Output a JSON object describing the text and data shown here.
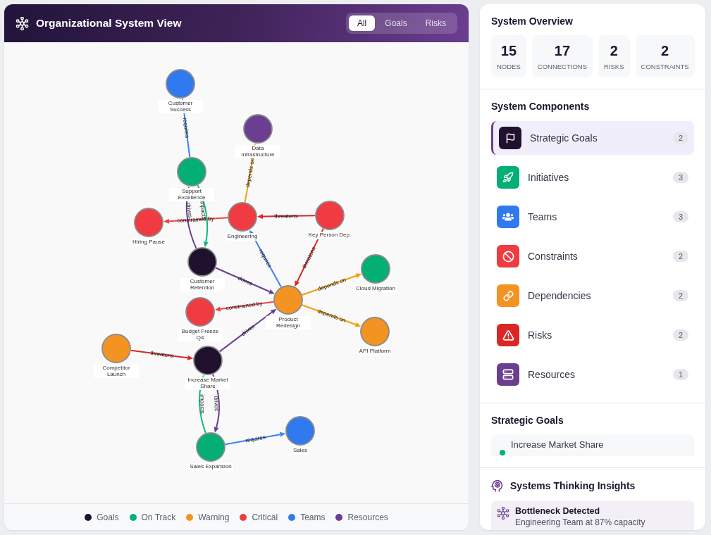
{
  "header": {
    "title": "Organizational System View",
    "tabs": [
      {
        "label": "All",
        "selected": true
      },
      {
        "label": "Goals",
        "selected": false
      },
      {
        "label": "Risks",
        "selected": false
      }
    ]
  },
  "graph": {
    "nodes": [
      {
        "label": "Customer Success",
        "color": "#3179ee"
      },
      {
        "label": "Data Infrastructure",
        "color": "#6c3e91"
      },
      {
        "label": "Support Excellence",
        "color": "#04af74"
      },
      {
        "label": "Engineering",
        "color": "#ef3b41"
      },
      {
        "label": "Key Person Dep.",
        "color": "#ef3b41"
      },
      {
        "label": "Hiring Pause",
        "color": "#ef3b41"
      },
      {
        "label": "Customer Retention",
        "color": "#20122f"
      },
      {
        "label": "Cloud Migration",
        "color": "#04af74"
      },
      {
        "label": "Product Redesign",
        "color": "#f39322"
      },
      {
        "label": "Budget Freeze Q4",
        "color": "#ef3b41"
      },
      {
        "label": "API Platform",
        "color": "#f39322"
      },
      {
        "label": "Competitor Launch",
        "color": "#f39322"
      },
      {
        "label": "Increase Market Share",
        "color": "#20122f"
      },
      {
        "label": "Sales",
        "color": "#3179ee"
      },
      {
        "label": "Sales Expansion",
        "color": "#04af74"
      }
    ],
    "edges": [
      {
        "label": "requires",
        "color": "#3b82f6"
      },
      {
        "label": "depends on",
        "color": "#f59e0b"
      },
      {
        "label": "threatens",
        "color": "#dc2626"
      },
      {
        "label": "constrained by",
        "color": "#ef4444"
      },
      {
        "label": "drives",
        "color": "#6c3e91"
      },
      {
        "label": "impacts",
        "color": "#10b981"
      },
      {
        "label": "requires",
        "color": "#3b82f6"
      },
      {
        "label": "threatens",
        "color": "#dc2626"
      },
      {
        "label": "drives",
        "color": "#6c3e91"
      },
      {
        "label": "depends on",
        "color": "#f59e0b"
      },
      {
        "label": "depends on",
        "color": "#f59e0b"
      },
      {
        "label": "constrained by",
        "color": "#ef4444"
      },
      {
        "label": "drives",
        "color": "#6c3e91"
      },
      {
        "label": "threatens",
        "color": "#dc2626"
      },
      {
        "label": "impacts",
        "color": "#10b981"
      },
      {
        "label": "drives",
        "color": "#6c3e91"
      },
      {
        "label": "requires",
        "color": "#3b82f6"
      }
    ]
  },
  "legend": [
    {
      "label": "Goals",
      "color": "#20122f"
    },
    {
      "label": "On Track",
      "color": "#04af74"
    },
    {
      "label": "Warning",
      "color": "#f39322"
    },
    {
      "label": "Critical",
      "color": "#ef3b41"
    },
    {
      "label": "Teams",
      "color": "#3179ee"
    },
    {
      "label": "Resources",
      "color": "#6c3e91"
    }
  ],
  "overview": {
    "title": "System Overview",
    "stats": [
      {
        "value": "15",
        "label": "NODES"
      },
      {
        "value": "17",
        "label": "CONNECTIONS"
      },
      {
        "value": "2",
        "label": "RISKS"
      },
      {
        "value": "2",
        "label": "CONSTRAINTS"
      }
    ]
  },
  "components": {
    "title": "System Components",
    "items": [
      {
        "label": "Strategic Goals",
        "count": "2",
        "color": "#20122f",
        "selected": true
      },
      {
        "label": "Initiatives",
        "count": "3",
        "color": "#04af74",
        "selected": false
      },
      {
        "label": "Teams",
        "count": "3",
        "color": "#3179ee",
        "selected": false
      },
      {
        "label": "Constraints",
        "count": "2",
        "color": "#ef3b41",
        "selected": false
      },
      {
        "label": "Dependencies",
        "count": "2",
        "color": "#f39322",
        "selected": false
      },
      {
        "label": "Risks",
        "count": "2",
        "color": "#dc2626",
        "selected": false
      },
      {
        "label": "Resources",
        "count": "1",
        "color": "#6c3e91",
        "selected": false
      }
    ]
  },
  "goals": {
    "title": "Strategic Goals",
    "items": [
      {
        "label": "Increase Market Share",
        "color": "#04af74"
      }
    ]
  },
  "insights": {
    "title": "Systems Thinking Insights",
    "items": [
      {
        "title": "Bottleneck Detected",
        "text": "Engineering Team at 87% capacity"
      }
    ]
  }
}
